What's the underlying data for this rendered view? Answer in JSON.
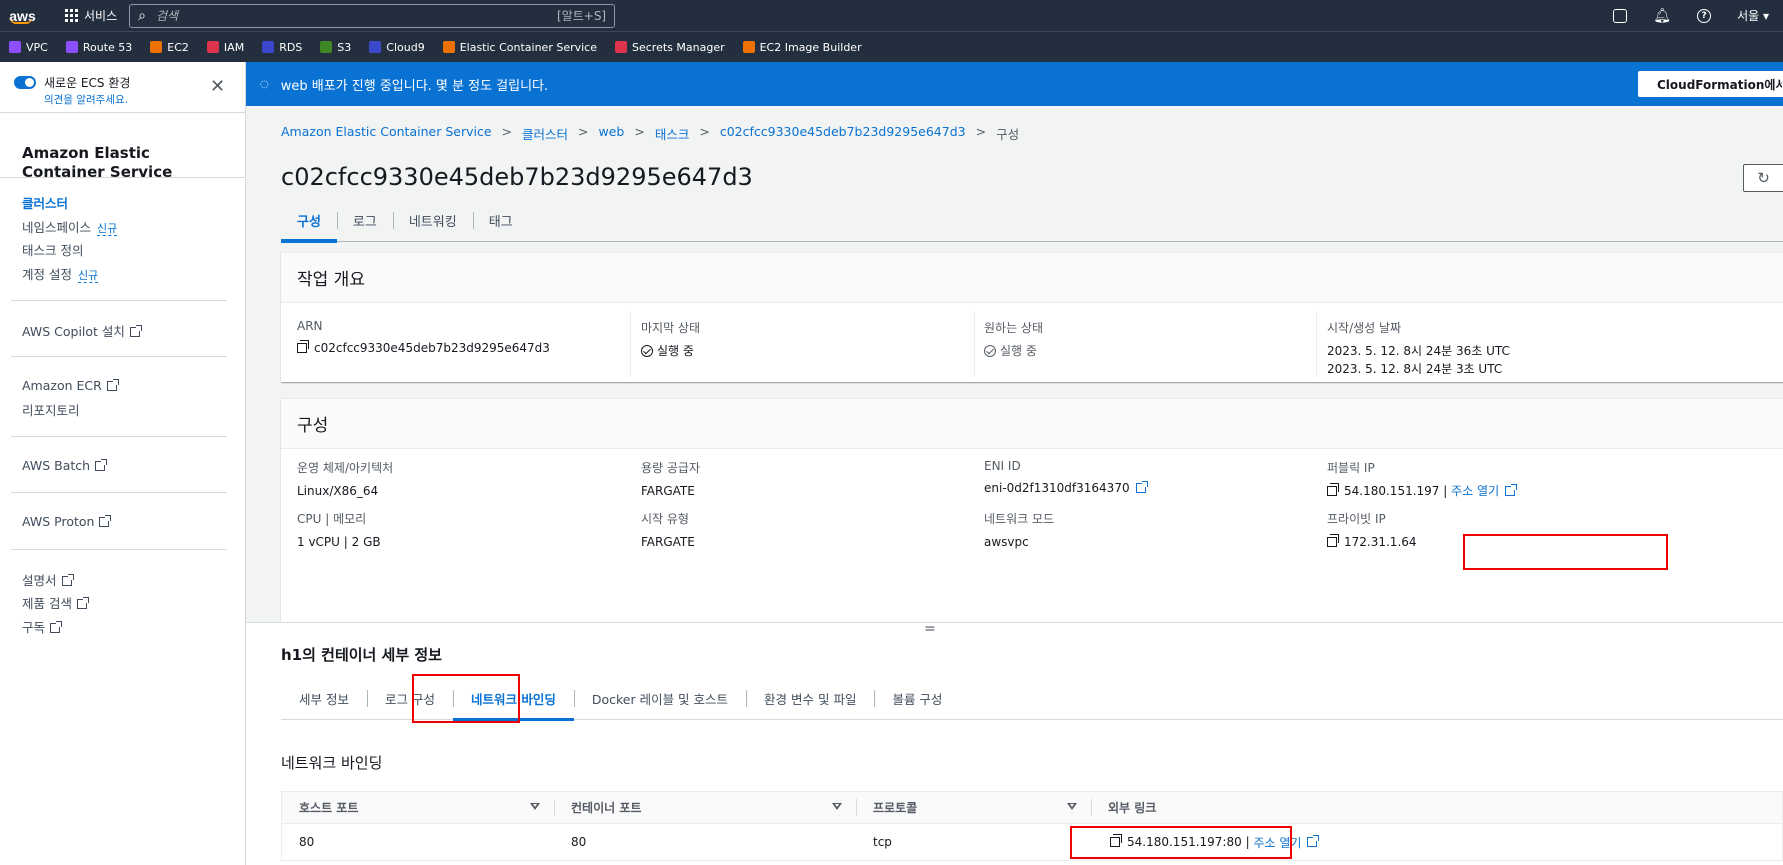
{
  "topbar": {
    "logo": "aws",
    "services_label": "서비스",
    "search_placeholder": "검색",
    "search_shortcut": "[알트+S]",
    "region": "서울 ▾"
  },
  "favorites": [
    {
      "label": "VPC",
      "color": "#8c4fff"
    },
    {
      "label": "Route 53",
      "color": "#8c4fff"
    },
    {
      "label": "EC2",
      "color": "#ed7100"
    },
    {
      "label": "IAM",
      "color": "#dd344c"
    },
    {
      "label": "RDS",
      "color": "#3b48cc"
    },
    {
      "label": "S3",
      "color": "#3f8624"
    },
    {
      "label": "Cloud9",
      "color": "#3b48cc"
    },
    {
      "label": "Elastic Container Service",
      "color": "#ed7100"
    },
    {
      "label": "Secrets Manager",
      "color": "#dd344c"
    },
    {
      "label": "EC2 Image Builder",
      "color": "#ed7100"
    }
  ],
  "sidebar": {
    "new_ecs_label": "새로운 ECS 환경",
    "feedback_link": "의견을 알려주세요.",
    "close_symbol": "✕",
    "title": "Amazon Elastic Container Service",
    "new_badge": "신규",
    "items": [
      {
        "label": "클러스터"
      },
      {
        "label": "네임스페이스"
      },
      {
        "label": "태스크 정의"
      },
      {
        "label": "계정 설정"
      }
    ],
    "external": {
      "copilot": "AWS Copilot 설치",
      "ecr": "Amazon ECR",
      "repos": "리포지토리",
      "batch": "AWS Batch",
      "proton": "AWS Proton",
      "docs": "설명서",
      "search": "제품 검색",
      "subscribe": "구독"
    }
  },
  "flash": {
    "message": "web 배포가 진행 중입니다. 몇 분 정도 걸립니다.",
    "button": "CloudFormation에서"
  },
  "breadcrumb": {
    "items": [
      "Amazon Elastic Container Service",
      "클러스터",
      "web",
      "태스크",
      "c02cfcc9330e45deb7b23d9295e647d3"
    ],
    "current": "구성"
  },
  "page_title": "c02cfcc9330e45deb7b23d9295e647d3",
  "tabs": [
    "구성",
    "로그",
    "네트워킹",
    "태그"
  ],
  "overview": {
    "title": "작업 개요",
    "arn_label": "ARN",
    "arn_value": "c02cfcc9330e45deb7b23d9295e647d3",
    "last_status_label": "마지막 상태",
    "last_status_value": "실행 중",
    "desired_status_label": "원하는 상태",
    "desired_status_value": "실행 중",
    "created_label": "시작/생성 날짜",
    "started_value": "2023. 5. 12. 8시 24분 36초 UTC",
    "created_value": "2023. 5. 12. 8시 24분 3초 UTC"
  },
  "config": {
    "title": "구성",
    "os_label": "운영 체제/아키텍처",
    "os_value": "Linux/X86_64",
    "capacity_label": "용량 공급자",
    "capacity_value": "FARGATE",
    "eni_label": "ENI ID",
    "eni_value": "eni-0d2f1310df3164370",
    "public_ip_label": "퍼블릭 IP",
    "public_ip_value": "54.180.151.197",
    "open_address": "주소 열기",
    "pipe": "|",
    "cpu_label": "CPU | 메모리",
    "cpu_value": "1 vCPU | 2 GB",
    "launch_label": "시작 유형",
    "launch_value": "FARGATE",
    "network_mode_label": "네트워크 모드",
    "network_mode_value": "awsvpc",
    "private_ip_label": "프라이빗 IP",
    "private_ip_value": "172.31.1.64"
  },
  "container": {
    "handle": "=",
    "title": "h1의 컨테이너 세부 정보",
    "tabs": [
      "세부 정보",
      "로그 구성",
      "네트워크 바인딩",
      "Docker 레이블 및 호스트",
      "환경 변수 및 파일",
      "볼륨 구성"
    ],
    "section_title": "네트워크 바인딩",
    "columns": [
      "호스트 포트",
      "컨테이너 포트",
      "프로토콜",
      "외부 링크"
    ],
    "rows": [
      {
        "host_port": "80",
        "container_port": "80",
        "protocol": "tcp",
        "external": "54.180.151.197:80",
        "open": "주소 열기"
      }
    ]
  }
}
